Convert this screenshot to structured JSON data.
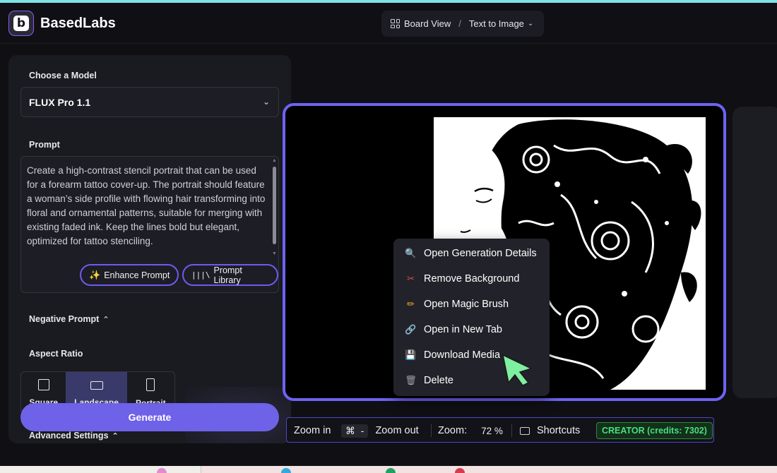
{
  "app": {
    "brand": "BasedLabs",
    "logo_letter": "b"
  },
  "breadcrumb": {
    "view": "Board View",
    "separator": "/",
    "page": "Text to Image"
  },
  "panel": {
    "model_label": "Choose a Model",
    "model_value": "FLUX Pro 1.1",
    "prompt_label": "Prompt",
    "prompt_text": "Create a high-contrast stencil portrait that can be used for a forearm tattoo cover-up. The portrait should feature a woman’s side profile with flowing hair transforming into floral and ornamental patterns, suitable for merging with existing faded ink. Keep the lines bold but elegant, optimized for tattoo stenciling.",
    "enhance_label": "Enhance Prompt",
    "library_label": "Prompt Library",
    "negative_label": "Negative Prompt",
    "aspect_label": "Aspect Ratio",
    "aspect_options": [
      {
        "label": "Square",
        "selected": false
      },
      {
        "label": "Landscape",
        "selected": true
      },
      {
        "label": "Portrait",
        "selected": false
      }
    ],
    "generate_label": "Generate",
    "advanced_label": "Advanced Settings"
  },
  "context_menu": {
    "items": [
      {
        "label": "Open Generation Details",
        "icon": "magnifier-icon"
      },
      {
        "label": "Remove Background",
        "icon": "scissors-icon"
      },
      {
        "label": "Open Magic Brush",
        "icon": "pencil-icon"
      },
      {
        "label": "Open in New Tab",
        "icon": "link-icon"
      },
      {
        "label": "Download Media",
        "icon": "floppy-icon"
      },
      {
        "label": "Delete",
        "icon": "trash-icon"
      }
    ]
  },
  "zoom": {
    "zoom_in": "Zoom in",
    "cmd_key": "⌘",
    "minus_key": "-",
    "zoom_out": "Zoom out",
    "zoom_label": "Zoom:",
    "zoom_value": "72 %",
    "shortcuts": "Shortcuts",
    "plan_badge": "CREATOR (credits: 7302)"
  },
  "colors": {
    "accent": "#6d63f2",
    "generate": "#6e62e8",
    "badge_green": "#4ade80",
    "cursor_green": "#7ef0a0"
  }
}
